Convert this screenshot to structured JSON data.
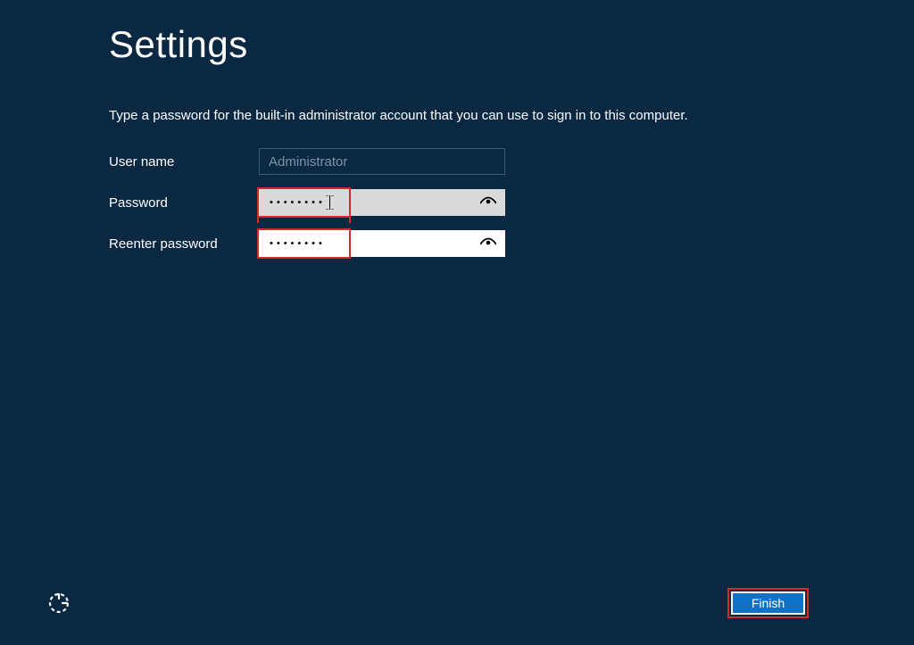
{
  "title": "Settings",
  "instruction": "Type a password for the built-in administrator account that you can use to sign in to this computer.",
  "form": {
    "username_label": "User name",
    "username_value": "Administrator",
    "password_label": "Password",
    "password_value": "••••••••",
    "reenter_label": "Reenter password",
    "reenter_value": "••••••••"
  },
  "buttons": {
    "finish": "Finish"
  },
  "colors": {
    "background": "#0a2842",
    "highlight": "#d42c2c",
    "button": "#0f72c4"
  }
}
